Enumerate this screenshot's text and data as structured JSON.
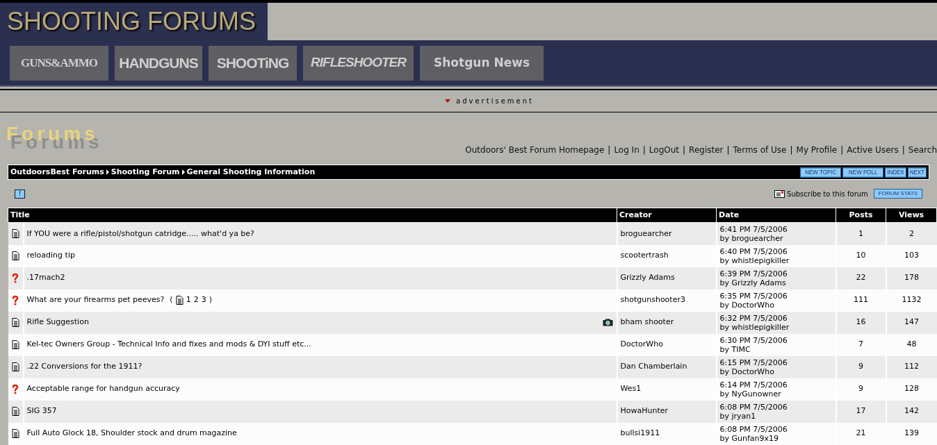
{
  "banner": {
    "title": "SHOOTING FORUMS"
  },
  "magazines": [
    {
      "label": "GUNS&AMMO",
      "kind": "serif"
    },
    {
      "label": "HANDGUNS",
      "kind": "block"
    },
    {
      "label": "SHOOTiNG",
      "kind": "block"
    },
    {
      "label": "RIFLESHOOTER",
      "kind": "italic"
    },
    {
      "label": "Shotgun News",
      "kind": "rounded"
    }
  ],
  "advertisement": "advertisement",
  "heading": {
    "title": "Forums"
  },
  "link_separator": "|",
  "top_links": [
    "Outdoors' Best Forum Homepage",
    "Log In",
    "LogOut",
    "Register",
    "Terms of Use",
    "My Profile",
    "Active Users",
    "Search"
  ],
  "breadcrumb": [
    "OutdoorsBest Forums",
    "Shooting Forum",
    "General Shooting Information"
  ],
  "nav_buttons": [
    "NEW TOPIC",
    "NEW POLL",
    "INDEX",
    "NEXT"
  ],
  "notice_button": "!",
  "subscribe": "Subscribe to this forum",
  "stats_button": "FORUM STATS",
  "table": {
    "columns": [
      "Title",
      "Creator",
      "Date",
      "Posts",
      "Views"
    ],
    "rows": [
      {
        "kind": "normal",
        "title": "If YOU were a rifle/pistol/shotgun catridge..... what'd ya be?",
        "creator": "broguearcher",
        "date": "6:41 PM 7/5/2006",
        "by": "by broguearcher",
        "posts": "1",
        "views": "2"
      },
      {
        "kind": "normal",
        "title": "reloading tip",
        "creator": "scootertrash",
        "date": "6:40 PM 7/5/2006",
        "by": "by whistlepigkiller",
        "posts": "10",
        "views": "103"
      },
      {
        "kind": "question",
        "title": ".17mach2",
        "creator": "Grizzly Adams",
        "date": "6:39 PM 7/5/2006",
        "by": "by Grizzly Adams",
        "posts": "22",
        "views": "178"
      },
      {
        "kind": "question",
        "title": "What are your firearms pet peeves?",
        "pages": {
          "open": "(",
          "links": [
            "1",
            "2",
            "3"
          ],
          "close": ")"
        },
        "creator": "shotgunshooter3",
        "date": "6:35 PM 7/5/2006",
        "by": "by DoctorWho",
        "posts": "111",
        "views": "1132"
      },
      {
        "kind": "normal",
        "title": "Rifle Suggestion",
        "photo": true,
        "creator": "bham shooter",
        "date": "6:32 PM 7/5/2006",
        "by": "by whistlepigkiller",
        "posts": "16",
        "views": "147"
      },
      {
        "kind": "normal",
        "title": "Kel-tec Owners Group - Technical Info and fixes and mods & DYI stuff etc...",
        "creator": "DoctorWho",
        "date": "6:30 PM 7/5/2006",
        "by": "by TIMC",
        "posts": "7",
        "views": "48"
      },
      {
        "kind": "normal",
        "title": ".22 Conversions for the 1911?",
        "creator": "Dan Chamberlain",
        "date": "6:15 PM 7/5/2006",
        "by": "by DoctorWho",
        "posts": "9",
        "views": "112"
      },
      {
        "kind": "question",
        "title": "Acceptable range for handgun accuracy",
        "creator": "Wes1",
        "date": "6:14 PM 7/5/2006",
        "by": "by NyGunowner",
        "posts": "9",
        "views": "128"
      },
      {
        "kind": "normal",
        "title": "SIG 357",
        "creator": "HowaHunter",
        "date": "6:08 PM 7/5/2006",
        "by": "by jryan1",
        "posts": "17",
        "views": "142"
      },
      {
        "kind": "normal",
        "title": "Full Auto Glock 18, Shoulder stock and drum magazine",
        "creator": "bullsi1911",
        "date": "6:08 PM 7/5/2006",
        "by": "by Gunfan9x19",
        "posts": "21",
        "views": "139"
      }
    ]
  }
}
